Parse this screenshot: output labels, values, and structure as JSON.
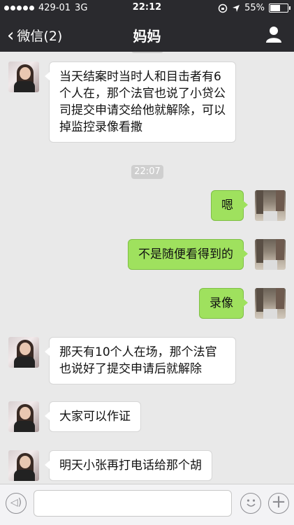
{
  "status_bar": {
    "carrier": "429-01",
    "network": "3G",
    "time": "22:12",
    "battery": "55%"
  },
  "nav": {
    "back_label": "微信(2)",
    "title": "妈妈"
  },
  "chat": {
    "timestamp": "22:07",
    "messages": [
      {
        "side": "in",
        "text": "当天结案时当时人和目击者有6个人在，那个法官也说了小贷公司提交申请交给他就解除，可以掉监控录像看撒"
      },
      {
        "side": "out",
        "text": "嗯"
      },
      {
        "side": "out",
        "text": "不是随便看得到的"
      },
      {
        "side": "out",
        "text": "录像"
      },
      {
        "side": "in",
        "text": "那天有10个人在场，那个法官也说好了提交申请后就解除"
      },
      {
        "side": "in",
        "text": "大家可以作证"
      },
      {
        "side": "in",
        "text": "明天小张再打电话给那个胡"
      }
    ]
  },
  "input_bar": {
    "icons": [
      "voice-icon",
      "emoji-icon",
      "plus-icon"
    ]
  }
}
